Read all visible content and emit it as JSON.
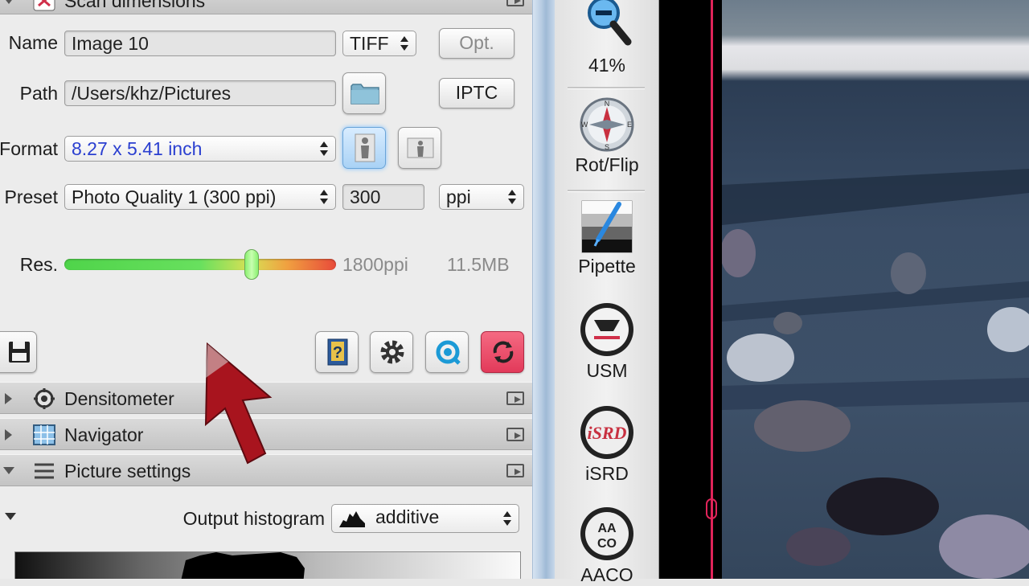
{
  "scan_dimensions": {
    "title": "Scan dimensions",
    "name_label": "Name",
    "name_value": "Image 10",
    "file_format": "TIFF",
    "options_button": "Opt.",
    "path_label": "Path",
    "path_value": "/Users/khz/Pictures",
    "iptc_button": "IPTC",
    "format_label": "Format",
    "format_value": "8.27 x 5.41 inch",
    "preset_label": "Preset",
    "preset_value": "Photo Quality 1 (300 ppi)",
    "resolution_value": "300",
    "resolution_unit": "ppi",
    "res_label": "Res.",
    "res_slider_fraction": 0.69,
    "res_ppi": "1800ppi",
    "res_size": "11.5MB"
  },
  "sections": {
    "densitometer": "Densitometer",
    "navigator": "Navigator",
    "picture_settings": "Picture settings"
  },
  "picture_settings": {
    "output_histogram_label": "Output histogram",
    "histogram_mode": "additive"
  },
  "toolbar": {
    "zoom_level": "41%",
    "rot_flip": "Rot/Flip",
    "pipette": "Pipette",
    "usm": "USM",
    "isrd": "iSRD",
    "aaco": "AACO"
  },
  "icons": {
    "save": "floppy-disk-icon",
    "help": "help-book-icon",
    "settings": "gear-icon",
    "preview": "preview-magnifier-icon",
    "scan": "scan-sync-icon",
    "zoom": "zoom-out-magnifier-icon",
    "compass": "compass-rotate-icon"
  },
  "colors": {
    "accent_pink": "#e0245a",
    "format_text": "#2a3fd0",
    "cursor_arrow": "#a8141e"
  }
}
